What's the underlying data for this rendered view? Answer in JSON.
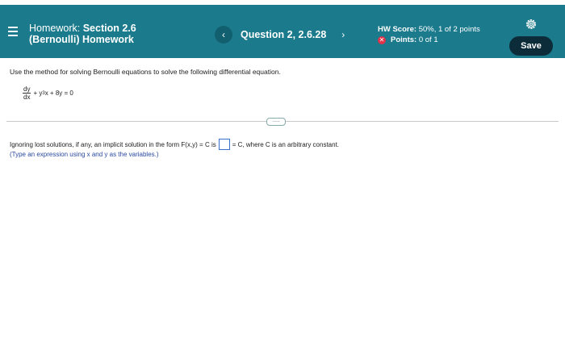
{
  "header": {
    "title_line1_prefix": "Homework:",
    "title_line1_bold": "Section 2.6",
    "title_line2": "(Bernoulli) Homework",
    "question_label": "Question 2, 2.6.28",
    "score_label": "HW Score:",
    "score_value": "50%, 1 of 2 points",
    "points_label": "Points:",
    "points_value": "0 of 1",
    "save_label": "Save",
    "prev_icon": "‹",
    "next_icon": "›",
    "x_icon": "✕"
  },
  "problem": {
    "prompt": "Use the method for solving Bernoulli equations to solve the following differential equation.",
    "eq_num": "dy",
    "eq_den": "dx",
    "eq_plus_y": "+ y",
    "eq_exp": "3",
    "eq_rest": "x + 8y = 0"
  },
  "answer": {
    "text_before": "Ignoring lost solutions, if any, an implicit solution in the form F(x,y) = C is",
    "text_after": "= C, where C is an arbitrary constant.",
    "input_value": "",
    "hint": "(Type an expression using x and y as the variables.)",
    "more_label": "....."
  },
  "colors": {
    "header_bg": "#1b7a8c",
    "save_bg": "#0d2c3a",
    "error_red": "#e0334a",
    "hint_blue": "#2b4aa0"
  }
}
